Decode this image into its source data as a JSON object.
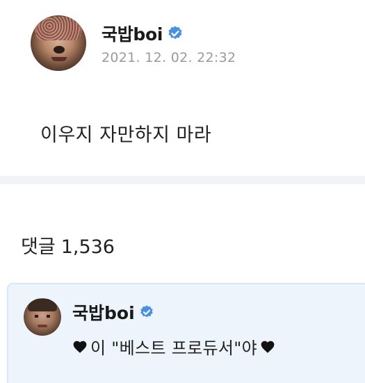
{
  "post": {
    "author": "국밥boi",
    "timestamp": "2021. 12. 02. 22:32",
    "body": "이우지 자만하지 마라"
  },
  "comments": {
    "label": "댓글",
    "count": "1,536",
    "items": [
      {
        "author": "국밥boi",
        "text": "이 \"베스트 프로듀서\"야"
      }
    ]
  },
  "icons": {
    "verified": "verified-badge-icon",
    "heart": "black-heart-icon"
  },
  "colors": {
    "verified": "#4a90e2",
    "timestamp": "#9a9a9a",
    "comment_bg": "#eef4fb",
    "comment_border": "#d7e7f7",
    "divider": "#f2f3f5"
  }
}
